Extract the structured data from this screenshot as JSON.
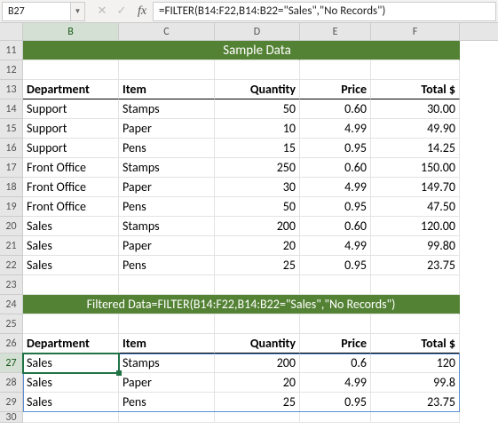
{
  "namebox": {
    "value": "B27"
  },
  "formula_bar": {
    "cancel": "✕",
    "accept": "✓",
    "fx": "fx",
    "formula": "=FILTER(B14:F22,B14:B22=\"Sales\",\"No Records\")"
  },
  "columns": [
    "B",
    "C",
    "D",
    "E",
    "F"
  ],
  "row_numbers": [
    "11",
    "12",
    "13",
    "14",
    "15",
    "16",
    "17",
    "18",
    "19",
    "20",
    "21",
    "22",
    "23",
    "24",
    "25",
    "26",
    "27",
    "28",
    "29",
    "30"
  ],
  "banner1": "Sample Data",
  "banner2": "Filtered Data=FILTER(B14:F22,B14:B22=\"Sales\",\"No Records\")",
  "headers": {
    "department": "Department",
    "item": "Item",
    "quantity": "Quantity",
    "price": "Price",
    "total": "Total  $"
  },
  "sample": [
    {
      "dept": "Support",
      "item": "Stamps",
      "qty": "50",
      "price": "0.60",
      "total": "30.00"
    },
    {
      "dept": "Support",
      "item": "Paper",
      "qty": "10",
      "price": "4.99",
      "total": "49.90"
    },
    {
      "dept": "Support",
      "item": "Pens",
      "qty": "15",
      "price": "0.95",
      "total": "14.25"
    },
    {
      "dept": "Front Office",
      "item": "Stamps",
      "qty": "250",
      "price": "0.60",
      "total": "150.00"
    },
    {
      "dept": "Front Office",
      "item": "Paper",
      "qty": "30",
      "price": "4.99",
      "total": "149.70"
    },
    {
      "dept": "Front Office",
      "item": "Pens",
      "qty": "50",
      "price": "0.95",
      "total": "47.50"
    },
    {
      "dept": "Sales",
      "item": "Stamps",
      "qty": "200",
      "price": "0.60",
      "total": "120.00"
    },
    {
      "dept": "Sales",
      "item": "Paper",
      "qty": "20",
      "price": "4.99",
      "total": "99.80"
    },
    {
      "dept": "Sales",
      "item": "Pens",
      "qty": "25",
      "price": "0.95",
      "total": "23.75"
    }
  ],
  "filtered": [
    {
      "dept": "Sales",
      "item": "Stamps",
      "qty": "200",
      "price": "0.6",
      "total": "120"
    },
    {
      "dept": "Sales",
      "item": "Paper",
      "qty": "20",
      "price": "4.99",
      "total": "99.8"
    },
    {
      "dept": "Sales",
      "item": "Pens",
      "qty": "25",
      "price": "0.95",
      "total": "23.75"
    }
  ]
}
